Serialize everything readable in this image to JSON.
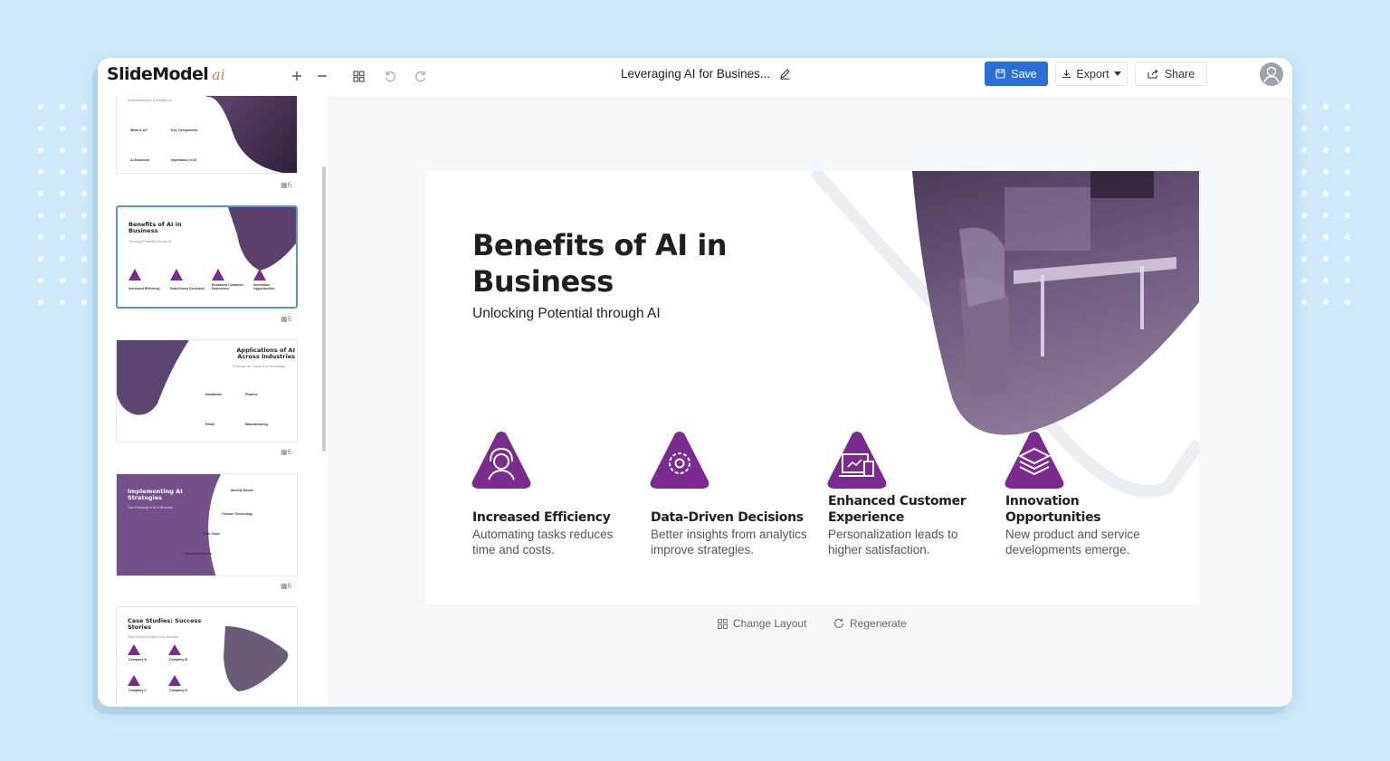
{
  "app": {
    "logo_main": "SlideModel",
    "logo_ai": "ai"
  },
  "toolbar": {
    "icons": [
      "plus-icon",
      "minus-icon",
      "grid-icon",
      "undo-icon",
      "redo-icon"
    ],
    "doc_title": "Leveraging AI for Busines...",
    "save_label": "Save",
    "export_label": "Export",
    "share_label": "Share"
  },
  "thumbnails": [
    {
      "title": "Understanding AI & Intelligence",
      "labels": [
        "What is AI?",
        "Key Components",
        "AI Evolution",
        "Importance of AI"
      ],
      "count": "6"
    },
    {
      "title": "Benefits of AI in Business",
      "subtitle": "Unlocking Potential through AI",
      "labels": [
        "Increased Efficiency",
        "Data-Driven Decisions",
        "Enhanced Customer Experience",
        "Innovation Opportunities"
      ],
      "count": "6"
    },
    {
      "title": "Applications of AI Across Industries",
      "subtitle": "Practical Use Cases of AI Technology",
      "labels": [
        "Healthcare",
        "Finance",
        "Retail",
        "Manufacturing"
      ],
      "count": "6"
    },
    {
      "title": "Implementing AI Strategies",
      "subtitle": "Your Roadmap to AI in Business",
      "labels": [
        "Identify Needs",
        "Choose Technology",
        "Train Team",
        "Monitor Progress"
      ],
      "count": "6"
    },
    {
      "title": "Case Studies: Success Stories",
      "subtitle": "Real-World Examples of AI Success",
      "labels": [
        "Company A",
        "Company B",
        "Company C",
        "Company D"
      ]
    }
  ],
  "slide": {
    "title": "Benefits of AI in Business",
    "subtitle": "Unlocking Potential through AI",
    "features": [
      {
        "icon": "user-headset-icon",
        "title": "Increased Efficiency",
        "desc": "Automating tasks reduces time and costs."
      },
      {
        "icon": "gear-icon",
        "title": "Data-Driven Decisions",
        "desc": "Better insights from analytics improve strategies."
      },
      {
        "icon": "devices-icon",
        "title": "Enhanced Customer Experience",
        "desc": "Personalization leads to higher satisfaction."
      },
      {
        "icon": "layers-icon",
        "title": "Innovation Opportunities",
        "desc": "New product and service developments emerge."
      }
    ]
  },
  "actions": {
    "change_layout": "Change Layout",
    "regenerate": "Regenerate"
  },
  "colors": {
    "accent": "#7b2a8f",
    "save": "#2b6fd4",
    "background": "#cde9fb"
  }
}
